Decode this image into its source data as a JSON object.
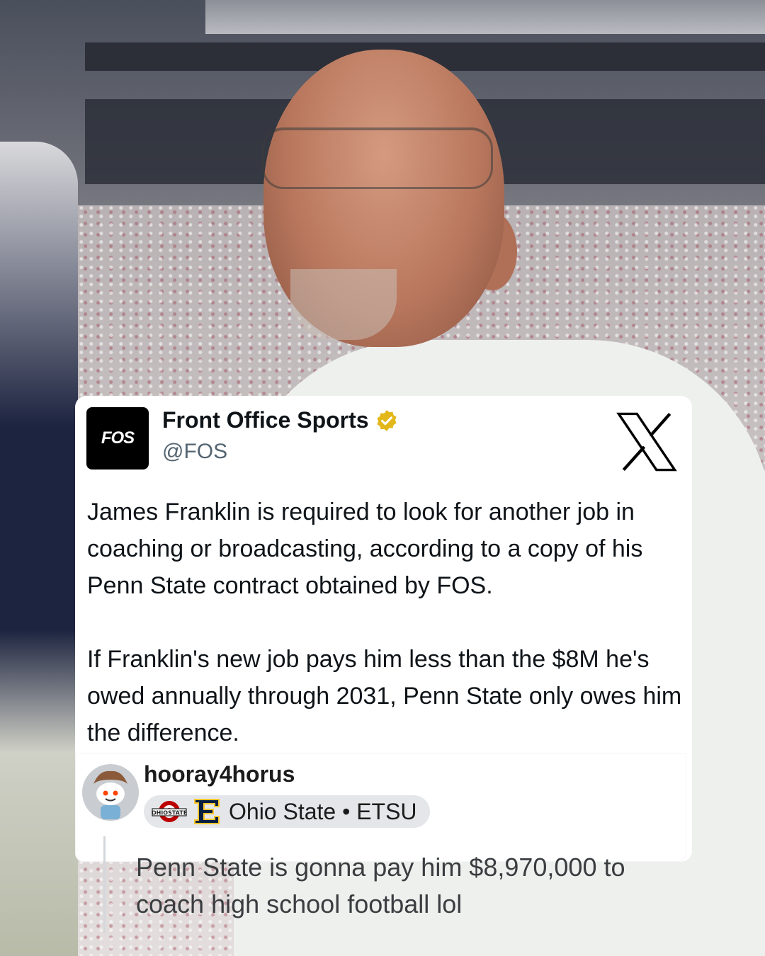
{
  "tweet": {
    "avatar_text": "FOS",
    "display_name": "Front Office Sports",
    "handle": "@FOS",
    "verified_icon": "gold-verified-badge-icon",
    "platform_icon": "x-logo-icon",
    "paragraphs": [
      "James Franklin is required to look for another job in coaching or broadcasting, according to a copy of his Penn State contract obtained by FOS.",
      "If Franklin's new job pays him less than the $8M he's owed annually through 2031, Penn State only owes him the difference."
    ]
  },
  "comment": {
    "username": "hooray4horus",
    "flair_text": "Ohio State • ETSU",
    "flair_icons": [
      "ohio-state-logo-icon",
      "etsu-logo-icon"
    ],
    "body": "Penn State is gonna pay him $8,970,000 to coach high school football lol"
  },
  "colors": {
    "card_bg": "#ffffff",
    "verified_gold": "#e2b719",
    "flair_bg": "#e4e6e9",
    "text_dark": "#0f1419",
    "text_muted": "#536471"
  }
}
